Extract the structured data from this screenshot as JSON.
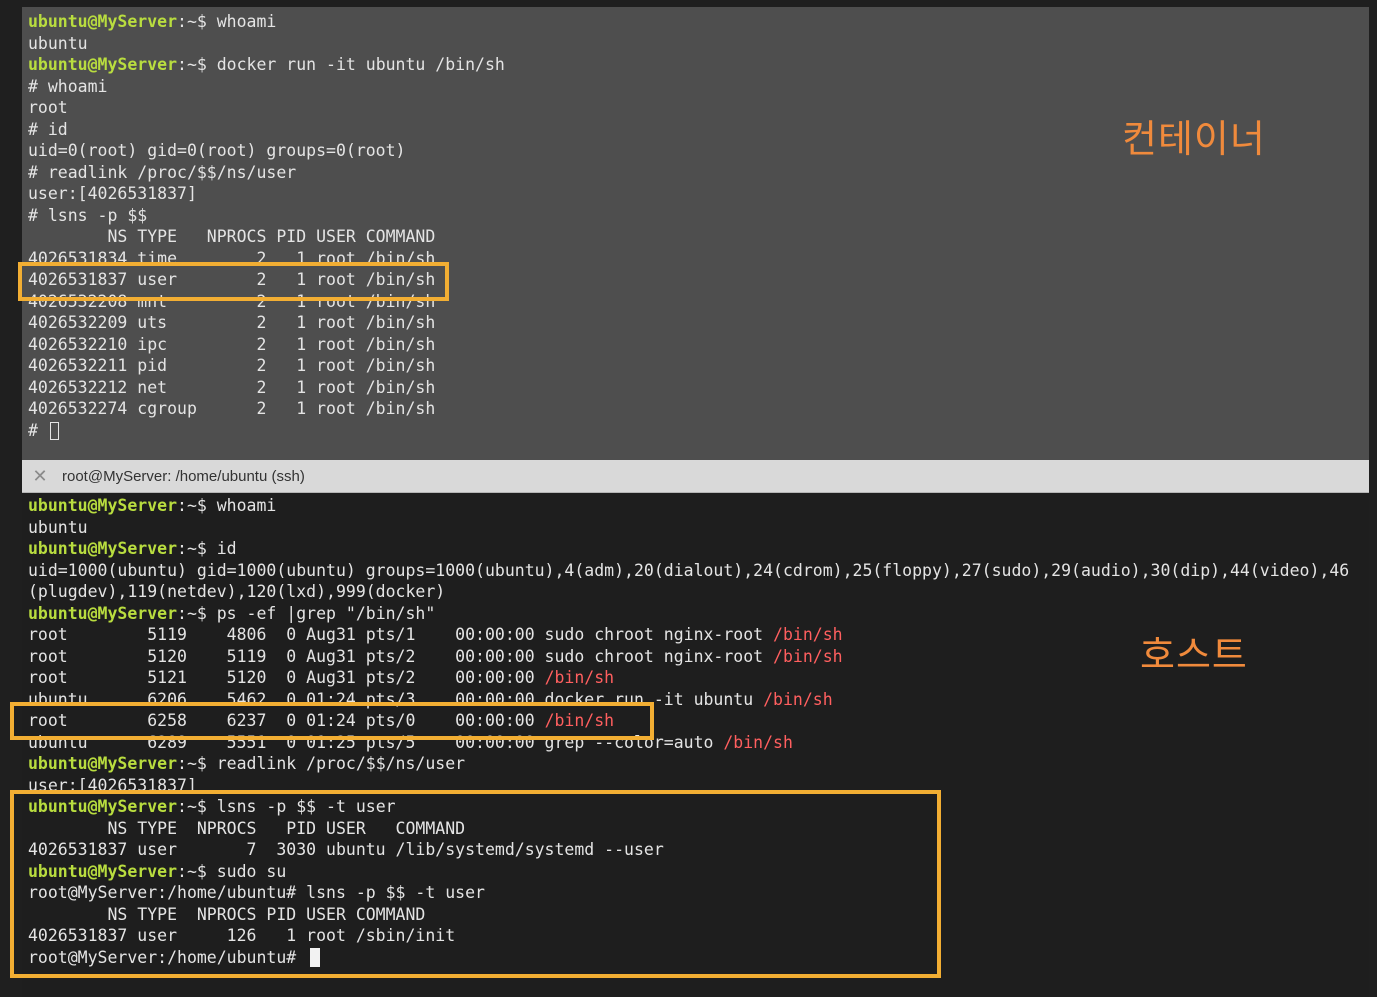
{
  "colors": {
    "prompt": "#b9dd3f",
    "highlight_path": "#ff5f5f",
    "highlight_box": "#f2ae33",
    "annotation": "#f08a3c",
    "top_background": "#4e4e4e",
    "bottom_background": "#1e1e1e"
  },
  "top_terminal": {
    "lines": [
      "ubuntu@MyServer:~$ whoami",
      "ubuntu",
      "ubuntu@MyServer:~$ docker run -it ubuntu /bin/sh",
      "# whoami",
      "root",
      "# id",
      "uid=0(root) gid=0(root) groups=0(root)",
      "# readlink /proc/$$/ns/user",
      "user:[4026531837]",
      "# lsns -p $$",
      "        NS TYPE   NPROCS PID USER COMMAND",
      "4026531834 time        2   1 root /bin/sh",
      "4026531837 user        2   1 root /bin/sh",
      "4026532208 mnt         2   1 root /bin/sh",
      "4026532209 uts         2   1 root /bin/sh",
      "4026532210 ipc         2   1 root /bin/sh",
      "4026532211 pid         2   1 root /bin/sh",
      "4026532212 net         2   1 root /bin/sh",
      "4026532274 cgroup      2   1 root /bin/sh",
      "# "
    ]
  },
  "tab": {
    "close_glyph": "✕",
    "title": "root@MyServer: /home/ubuntu (ssh)"
  },
  "bottom_terminal": {
    "lines": [
      "ubuntu@MyServer:~$ whoami",
      "ubuntu",
      "ubuntu@MyServer:~$ id",
      "uid=1000(ubuntu) gid=1000(ubuntu) groups=1000(ubuntu),4(adm),20(dialout),24(cdrom),25(floppy),27(sudo),29(audio),30(dip),44(video),46",
      "(plugdev),119(netdev),120(lxd),999(docker)",
      "ubuntu@MyServer:~$ ps -ef |grep \"/bin/sh\"",
      "root        5119    4806  0 Aug31 pts/1    00:00:00 sudo chroot nginx-root /bin/sh",
      "root        5120    5119  0 Aug31 pts/2    00:00:00 sudo chroot nginx-root /bin/sh",
      "root        5121    5120  0 Aug31 pts/2    00:00:00 /bin/sh",
      "ubuntu      6206    5462  0 01:24 pts/3    00:00:00 docker run -it ubuntu /bin/sh",
      "root        6258    6237  0 01:24 pts/0    00:00:00 /bin/sh",
      "ubuntu      6289    5551  0 01:25 pts/5    00:00:00 grep --color=auto /bin/sh",
      "ubuntu@MyServer:~$ readlink /proc/$$/ns/user",
      "user:[4026531837]",
      "ubuntu@MyServer:~$ lsns -p $$ -t user",
      "        NS TYPE  NPROCS   PID USER   COMMAND",
      "4026531837 user       7  3030 ubuntu /lib/systemd/systemd --user",
      "ubuntu@MyServer:~$ sudo su",
      "root@MyServer:/home/ubuntu# lsns -p $$ -t user",
      "        NS TYPE  NPROCS PID USER COMMAND",
      "4026531837 user     126   1 root /sbin/init",
      "root@MyServer:/home/ubuntu# "
    ]
  },
  "annotations": {
    "container": "컨테이너",
    "host": "호스트"
  }
}
